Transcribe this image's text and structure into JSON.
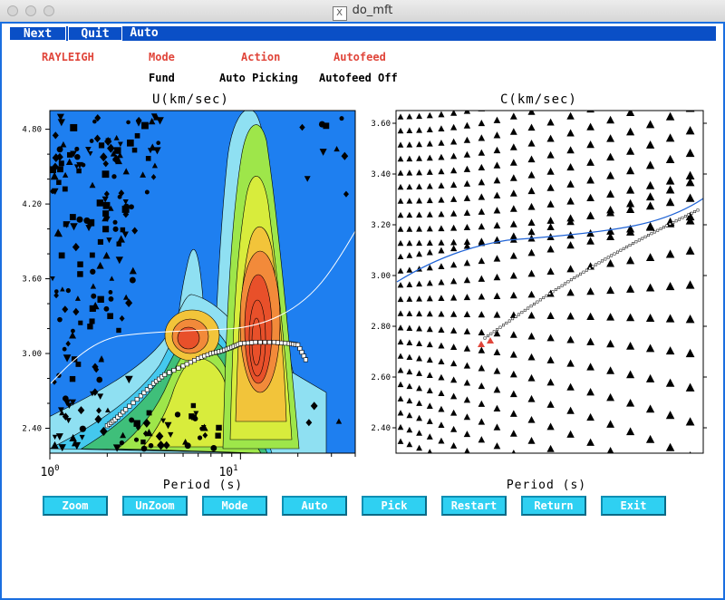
{
  "window": {
    "title": "do_mft"
  },
  "menu": {
    "next": "Next",
    "quit": "Quit",
    "auto": "Auto"
  },
  "header": {
    "wave_label": "RAYLEIGH",
    "mode_label": "Mode",
    "mode_value": "Fund",
    "action_label": "Action",
    "action_value": "Auto Picking",
    "autofeed_label": "Autofeed",
    "autofeed_value": "Autofeed Off"
  },
  "left_plot": {
    "title": "U(km/sec)",
    "xlabel": "Period (s)",
    "y_ticks": [
      "4.80",
      "4.20",
      "3.60",
      "3.00",
      "2.40"
    ],
    "x_ticks": [
      "10^0",
      "10^1"
    ],
    "x_tick_base": "10",
    "x_tick_exps": [
      "0",
      "1"
    ]
  },
  "right_plot": {
    "title": "C(km/sec)",
    "xlabel": "Period (s)",
    "y_ticks": [
      "3.60",
      "3.40",
      "3.20",
      "3.00",
      "2.80",
      "2.60",
      "2.40"
    ]
  },
  "buttons": [
    "Zoom",
    "UnZoom",
    "Mode",
    "Auto",
    "Pick",
    "Restart",
    "Return",
    "Exit"
  ],
  "colors": {
    "background": "#1e7ff0",
    "selection": "#0a4fc6",
    "button": "#2fd0f2",
    "accent_red": "#e0453a"
  },
  "chart_data": [
    {
      "type": "heatmap",
      "title": "U(km/sec)",
      "xlabel": "Period (s)",
      "ylabel": "",
      "xscale": "log",
      "xlim": [
        1,
        40
      ],
      "ylim": [
        2.2,
        4.95
      ],
      "picked_group_velocity": {
        "x": [
          2.0,
          2.2,
          2.5,
          3.0,
          3.5,
          4.0,
          5.0,
          6.0,
          7.0,
          8.0,
          9.0,
          10.0,
          12.0,
          15.0,
          18.0,
          20.0,
          22.0
        ],
        "y": [
          2.42,
          2.47,
          2.55,
          2.66,
          2.76,
          2.83,
          2.9,
          2.96,
          3.0,
          3.02,
          3.05,
          3.08,
          3.09,
          3.09,
          3.08,
          3.07,
          2.95
        ]
      }
    },
    {
      "type": "scatter",
      "title": "C(km/sec)",
      "xlabel": "Period (s)",
      "ylabel": "",
      "xscale": "log",
      "xlim": [
        1,
        40
      ],
      "ylim": [
        2.3,
        3.65
      ]
    }
  ]
}
